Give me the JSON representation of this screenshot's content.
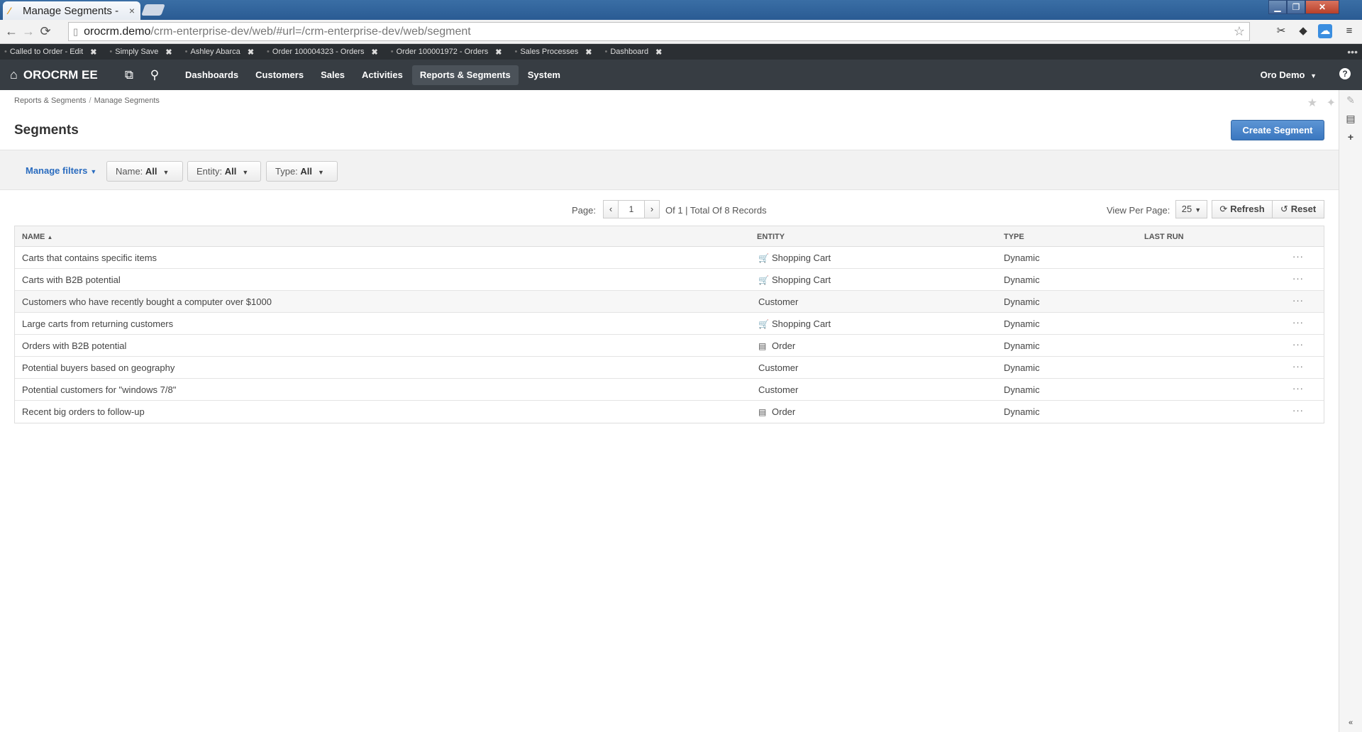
{
  "browser": {
    "tab_title": "Manage Segments -",
    "url_host": "orocrm.demo",
    "url_path": "/crm-enterprise-dev/web/#url=/crm-enterprise-dev/web/segment"
  },
  "pinbar": {
    "items": [
      {
        "label": "Called to Order - Edit"
      },
      {
        "label": "Simply Save"
      },
      {
        "label": "Ashley Abarca"
      },
      {
        "label": "Order 100004323 - Orders"
      },
      {
        "label": "Order 100001972 - Orders"
      },
      {
        "label": "Sales Processes"
      },
      {
        "label": "Dashboard"
      }
    ]
  },
  "nav": {
    "brand": "OROCRM EE",
    "menu": [
      "Dashboards",
      "Customers",
      "Sales",
      "Activities",
      "Reports & Segments",
      "System"
    ],
    "active": "Reports & Segments",
    "user": "Oro Demo"
  },
  "breadcrumb": [
    "Reports & Segments",
    "Manage Segments"
  ],
  "page": {
    "title": "Segments",
    "create_button": "Create Segment"
  },
  "filters": {
    "manage": "Manage filters",
    "name_label": "Name:",
    "name_value": "All",
    "entity_label": "Entity:",
    "entity_value": "All",
    "type_label": "Type:",
    "type_value": "All"
  },
  "pagination": {
    "page_label": "Page:",
    "current": "1",
    "of_text": "Of 1 | Total Of 8 Records",
    "per_page_label": "View Per Page:",
    "per_page": "25",
    "refresh": "Refresh",
    "reset": "Reset"
  },
  "grid": {
    "columns": [
      "Name",
      "Entity",
      "Type",
      "Last Run"
    ],
    "rows": [
      {
        "name": "Carts that contains specific items",
        "entity": "Shopping Cart",
        "icon": "cart-icon",
        "type": "Dynamic"
      },
      {
        "name": "Carts with B2B potential",
        "entity": "Shopping Cart",
        "icon": "cart-icon",
        "type": "Dynamic"
      },
      {
        "name": "Customers who have recently bought a computer over $1000",
        "entity": "Customer",
        "icon": "",
        "type": "Dynamic"
      },
      {
        "name": "Large carts from returning customers",
        "entity": "Shopping Cart",
        "icon": "cart-icon",
        "type": "Dynamic"
      },
      {
        "name": "Orders with B2B potential",
        "entity": "Order",
        "icon": "order-icon",
        "type": "Dynamic"
      },
      {
        "name": "Potential buyers based on geography",
        "entity": "Customer",
        "icon": "",
        "type": "Dynamic"
      },
      {
        "name": "Potential customers for \"windows 7/8\"",
        "entity": "Customer",
        "icon": "",
        "type": "Dynamic"
      },
      {
        "name": "Recent big orders to follow-up",
        "entity": "Order",
        "icon": "order-icon",
        "type": "Dynamic"
      }
    ]
  },
  "colors": {
    "nav_bg": "#373d43",
    "pinbar_bg": "#2b2f33",
    "primary_button": "#3a77c0",
    "link": "#2a6cbf"
  }
}
